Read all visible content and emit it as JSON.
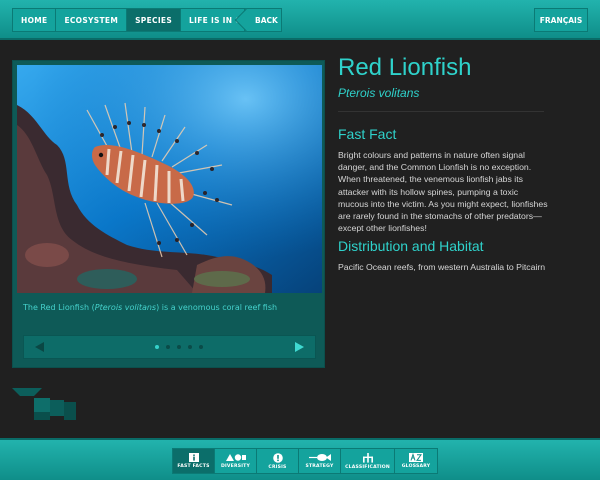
{
  "nav": {
    "items": [
      {
        "label": "HOME",
        "active": false
      },
      {
        "label": "ECOSYSTEM",
        "active": false
      },
      {
        "label": "SPECIES",
        "active": true
      },
      {
        "label": "LIFE IS IN CRISIS",
        "active": false
      }
    ],
    "back_label": "BACK",
    "language_label": "FRANÇAIS"
  },
  "species": {
    "common_name": "Red Lionfish",
    "scientific_name": "Pterois volitans",
    "fast_fact_heading": "Fast Fact",
    "fast_fact_text": "Bright colours and patterns in nature often signal danger, and the Common Lionfish is no exception. When threatened, the venemous lionfish jabs its attacker with its hollow spines, pumping a toxic mucous into the victim. As you might expect, lionfishes are rarely found in the stomachs of other predators—except other lionfishes!",
    "distribution_heading": "Distribution and Habitat",
    "distribution_text": "Pacific Ocean reefs, from western Australia to Pitcairn"
  },
  "gallery": {
    "caption_prefix": "The Red Lionfish (",
    "caption_italic": "Pterois volitans",
    "caption_suffix": ") is a venomous coral reef fish",
    "slide_count": 5,
    "active_slide": 1,
    "prev_icon": "triangle-left-icon",
    "next_icon": "triangle-right-icon"
  },
  "bottom_tabs": [
    {
      "label": "FAST FACTS",
      "icon": "info-icon",
      "active": true
    },
    {
      "label": "DIVERSITY",
      "icon": "shapes-icon",
      "active": false
    },
    {
      "label": "CRISIS",
      "icon": "alert-icon",
      "active": false
    },
    {
      "label": "STRATEGY",
      "icon": "fish-icon",
      "active": false
    },
    {
      "label": "CLASSIFICATION",
      "icon": "tree-icon",
      "active": false
    },
    {
      "label": "GLOSSARY",
      "icon": "az-icon",
      "active": false
    }
  ],
  "colors": {
    "accent": "#2fd2cb",
    "bar": "#1aa8a2",
    "background": "#202020"
  }
}
